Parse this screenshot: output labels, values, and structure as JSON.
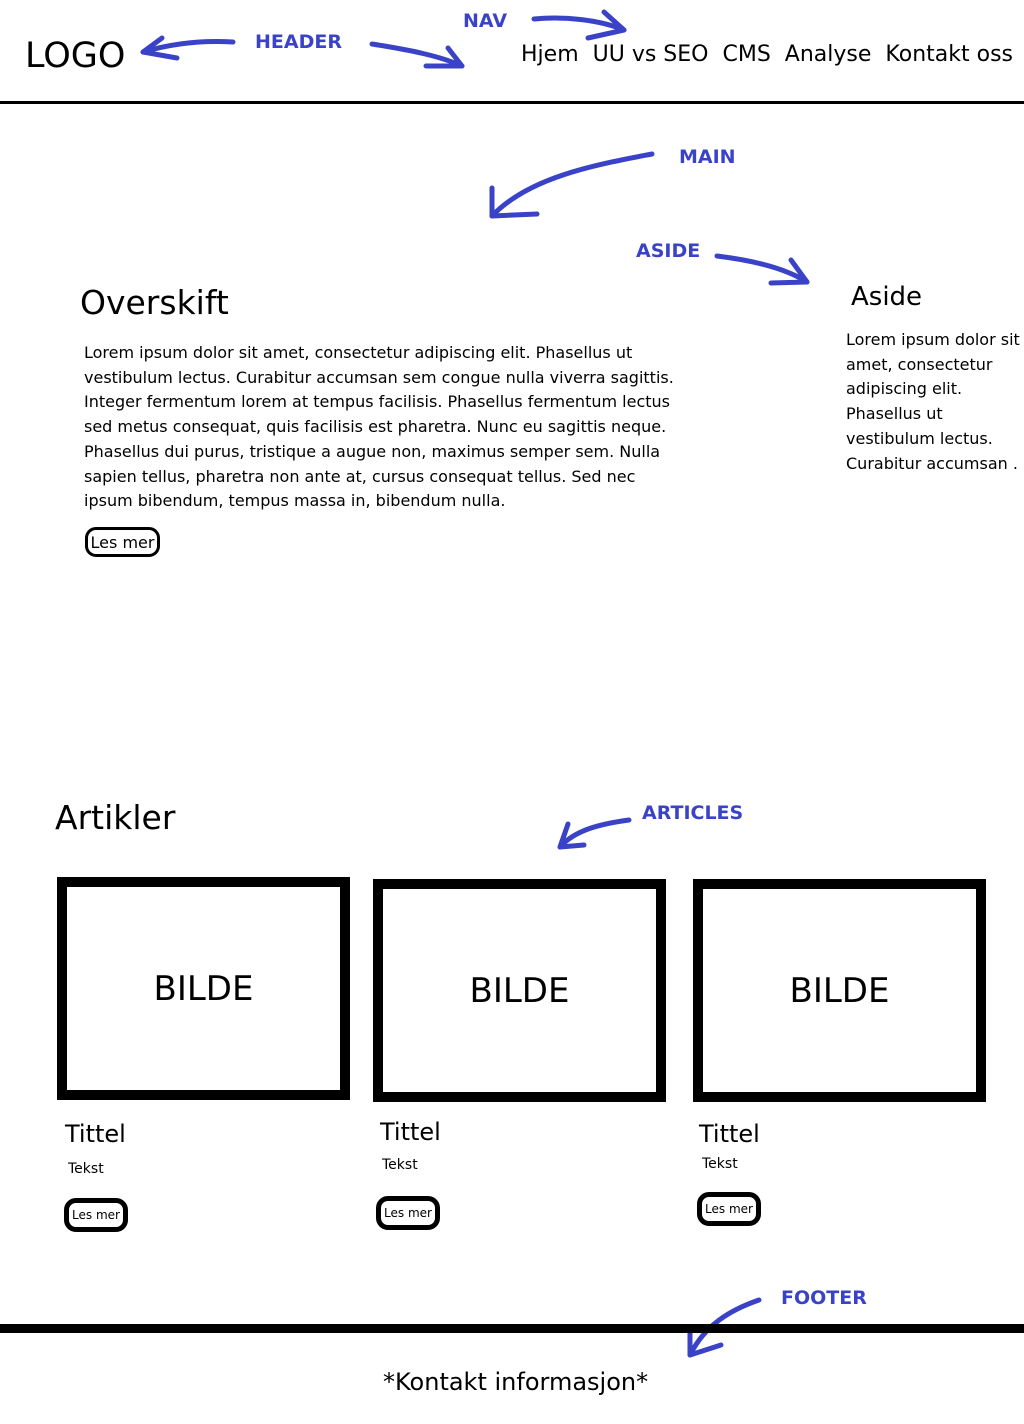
{
  "header": {
    "logo": "LOGO",
    "nav": [
      "Hjem",
      "UU vs SEO",
      "CMS",
      "Analyse",
      "Kontakt oss"
    ]
  },
  "annotations": {
    "header": "HEADER",
    "nav": "NAV",
    "main": "MAIN",
    "aside": "ASIDE",
    "articles": "ARTICLES",
    "footer": "FOOTER"
  },
  "main": {
    "heading": "Overskift",
    "body": "Lorem ipsum dolor sit amet, consectetur adipiscing elit. Phasellus ut vestibulum lectus. Curabitur accumsan sem congue nulla viverra sagittis. Integer fermentum lorem at tempus facilisis. Phasellus fermentum lectus sed metus consequat, quis facilisis est pharetra. Nunc eu sagittis neque. Phasellus dui purus, tristique a augue non, maximus semper sem. Nulla sapien tellus, pharetra non ante at, cursus consequat tellus. Sed nec ipsum bibendum, tempus massa in, bibendum nulla.",
    "button": "Les mer"
  },
  "aside": {
    "heading": "Aside",
    "body": "Lorem ipsum dolor sit amet, consectetur adipiscing elit. Phasellus ut vestibulum lectus. Curabitur accumsan ."
  },
  "articles": {
    "heading": "Artikler",
    "cards": [
      {
        "image": "BILDE",
        "title": "Tittel",
        "text": "Tekst",
        "button": "Les mer"
      },
      {
        "image": "BILDE",
        "title": "Tittel",
        "text": "Tekst",
        "button": "Les mer"
      },
      {
        "image": "BILDE",
        "title": "Tittel",
        "text": "Tekst",
        "button": "Les mer"
      }
    ]
  },
  "footer": {
    "text": "*Kontakt informasjon*"
  },
  "colors": {
    "annotation": "#3a43c8",
    "ink": "#000000",
    "background": "#ffffff"
  }
}
